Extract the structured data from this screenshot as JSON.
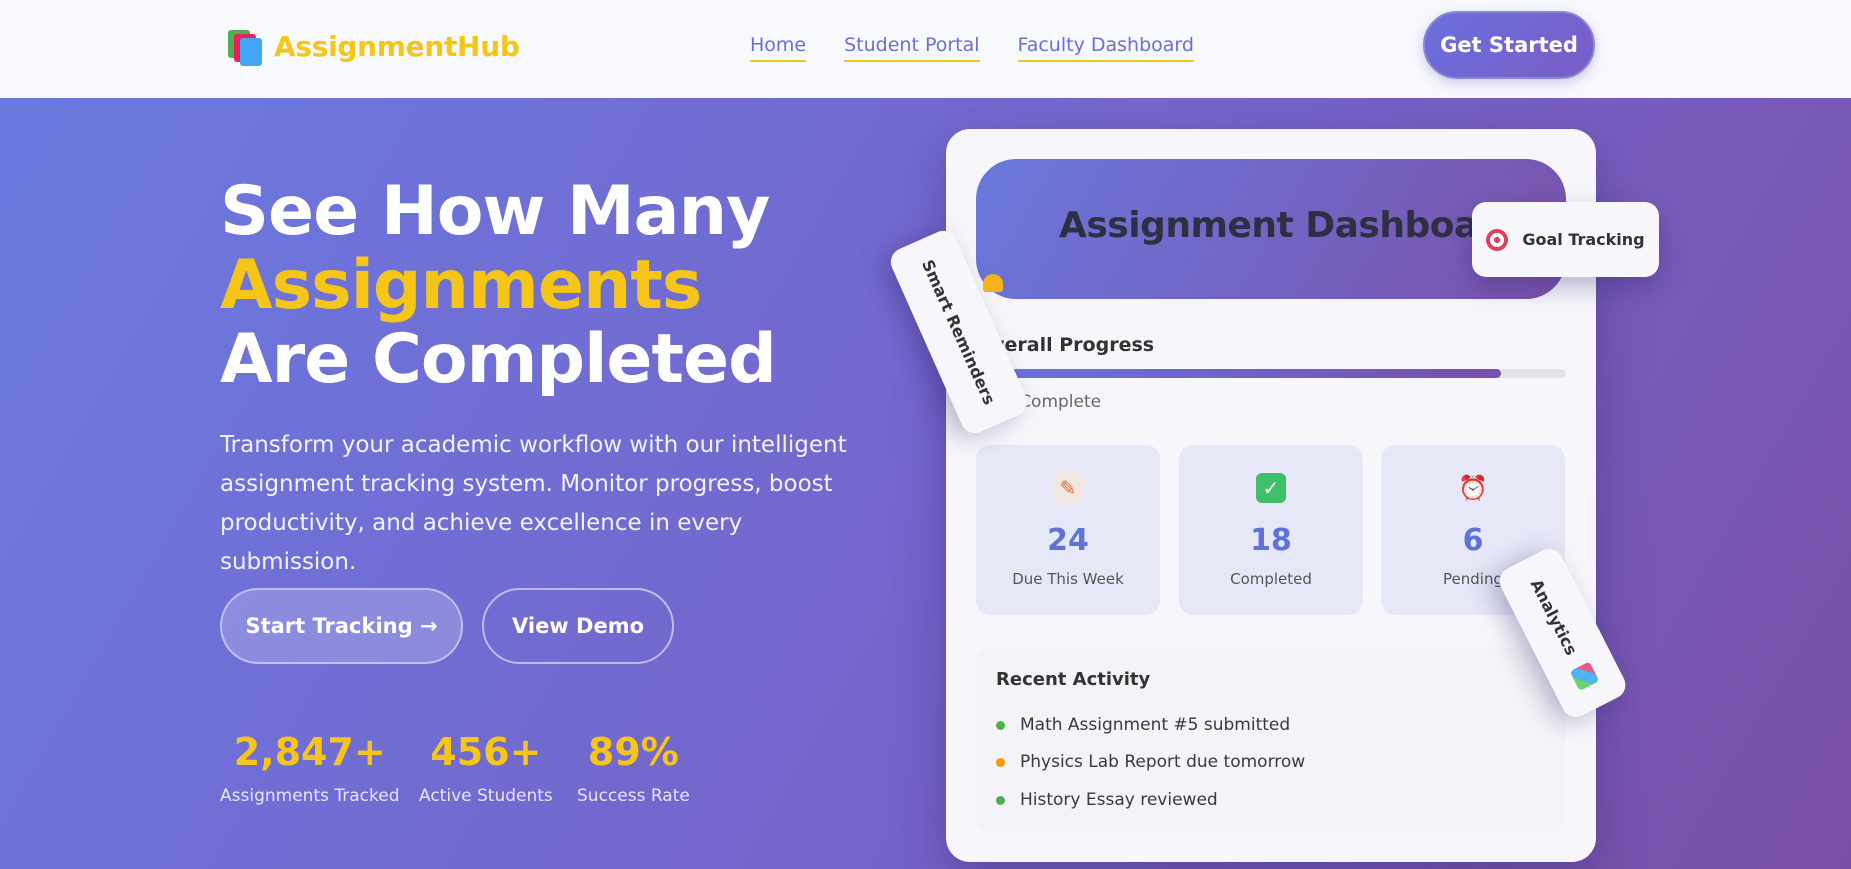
{
  "header": {
    "brand": "AssignmentHub",
    "nav": [
      "Home",
      "Student Portal",
      "Faculty Dashboard"
    ],
    "cta": "Get Started"
  },
  "hero": {
    "line1": "See How Many",
    "line2": "Assignments",
    "line3": "Are Completed",
    "description": "Transform your academic workflow with our intelligent assignment tracking system. Monitor progress, boost productivity, and achieve excellence in every submission.",
    "primary_button": "Start Tracking →",
    "secondary_button": "View Demo",
    "stats": [
      {
        "value": "2,847+",
        "label": "Assignments Tracked"
      },
      {
        "value": "456+",
        "label": "Active Students"
      },
      {
        "value": "89%",
        "label": "Success Rate"
      }
    ]
  },
  "dashboard": {
    "title": "Assignment Dashboard",
    "progress_label": "Overall Progress",
    "progress_fraction": 0.89,
    "progress_text": "89% Complete",
    "tiles": [
      {
        "icon": "memo-icon",
        "value": "24",
        "label": "Due This Week"
      },
      {
        "icon": "checkmark-icon",
        "value": "18",
        "label": "Completed"
      },
      {
        "icon": "alarm-clock-icon",
        "value": "6",
        "label": "Pending"
      }
    ],
    "activity_title": "Recent Activity",
    "activities": [
      {
        "text": "Math Assignment #5 submitted",
        "color": "#4caf50"
      },
      {
        "text": "Physics Lab Report due tomorrow",
        "color": "#ff9800"
      },
      {
        "text": "History Essay reviewed",
        "color": "#4caf50"
      }
    ]
  },
  "badges": {
    "goal": "Goal Tracking",
    "reminders": "Smart Reminders",
    "analytics": "Analytics"
  },
  "colors": {
    "accent": "#f5c518",
    "hero_start": "#6a7ae0",
    "hero_end": "#7a4fa8",
    "stat_number": "#5f72d6"
  }
}
